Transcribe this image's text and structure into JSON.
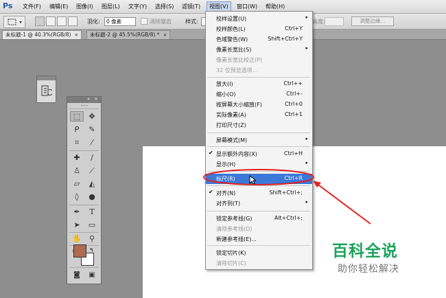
{
  "app": {
    "logo": "Ps"
  },
  "menubar": {
    "items": [
      "文件(F)",
      "编辑(E)",
      "图像(I)",
      "图层(L)",
      "文字(Y)",
      "选择(S)",
      "滤镜(T)",
      "视图(V)",
      "窗口(W)",
      "帮助(H)"
    ]
  },
  "options": {
    "feather_label": "羽化:",
    "feather_value": "0 像素",
    "antialias_label": "消除锯齿",
    "style_label": "样式:",
    "height_label": "高度:",
    "refine_edge": "调整边缘..."
  },
  "tabs": [
    {
      "label": "未标题-1 @ 40.3%(RGB/8)",
      "close": "×"
    },
    {
      "label": "未标题-2 @ 45.5%(RGB/8) *",
      "close": "×"
    }
  ],
  "view_menu": {
    "items": [
      {
        "label": "校样设置(U)",
        "shortcut": "",
        "submenu": true,
        "disabled": false,
        "checked": false
      },
      {
        "label": "校样颜色(L)",
        "shortcut": "Ctrl+Y",
        "submenu": false,
        "disabled": false,
        "checked": false
      },
      {
        "label": "色域警告(W)",
        "shortcut": "Shift+Ctrl+Y",
        "submenu": false,
        "disabled": false,
        "checked": false
      },
      {
        "label": "像素长宽比(S)",
        "shortcut": "",
        "submenu": true,
        "disabled": false,
        "checked": false
      },
      {
        "label": "像素长宽比校正(P)",
        "shortcut": "",
        "submenu": false,
        "disabled": true,
        "checked": false
      },
      {
        "label": "32 位预览选项...",
        "shortcut": "",
        "submenu": false,
        "disabled": true,
        "checked": false
      },
      {
        "label": "放大(I)",
        "shortcut": "Ctrl++",
        "submenu": false,
        "disabled": false,
        "checked": false
      },
      {
        "label": "缩小(O)",
        "shortcut": "Ctrl+-",
        "submenu": false,
        "disabled": false,
        "checked": false
      },
      {
        "label": "按屏幕大小缩放(F)",
        "shortcut": "Ctrl+0",
        "submenu": false,
        "disabled": false,
        "checked": false
      },
      {
        "label": "实际像素(A)",
        "shortcut": "Ctrl+1",
        "submenu": false,
        "disabled": false,
        "checked": false
      },
      {
        "label": "打印尺寸(Z)",
        "shortcut": "",
        "submenu": false,
        "disabled": false,
        "checked": false
      },
      {
        "label": "屏幕模式(M)",
        "shortcut": "",
        "submenu": true,
        "disabled": false,
        "checked": false
      },
      {
        "label": "显示额外内容(X)",
        "shortcut": "Ctrl+H",
        "submenu": false,
        "disabled": false,
        "checked": true
      },
      {
        "label": "显示(H)",
        "shortcut": "",
        "submenu": true,
        "disabled": false,
        "checked": false
      },
      {
        "label": "标尺(R)",
        "shortcut": "Ctrl+R",
        "submenu": false,
        "disabled": false,
        "checked": false,
        "highlighted": true
      },
      {
        "label": "对齐(N)",
        "shortcut": "Shift+Ctrl+;",
        "submenu": false,
        "disabled": false,
        "checked": true
      },
      {
        "label": "对齐到(T)",
        "shortcut": "",
        "submenu": true,
        "disabled": false,
        "checked": false
      },
      {
        "label": "锁定参考线(G)",
        "shortcut": "Alt+Ctrl+;",
        "submenu": false,
        "disabled": false,
        "checked": false
      },
      {
        "label": "清除参考线(D)",
        "shortcut": "",
        "submenu": false,
        "disabled": true,
        "checked": false
      },
      {
        "label": "新建参考线(E)...",
        "shortcut": "",
        "submenu": false,
        "disabled": false,
        "checked": false
      },
      {
        "label": "锁定切片(K)",
        "shortcut": "",
        "submenu": false,
        "disabled": false,
        "checked": false
      },
      {
        "label": "清除切片(C)",
        "shortcut": "",
        "submenu": false,
        "disabled": true,
        "checked": false
      }
    ]
  },
  "colors": {
    "foreground": "#b06a50",
    "background": "#ffffff",
    "highlight": "#3c78d8",
    "annotation_red": "#e02020",
    "watermark_green": "#1aa35a"
  },
  "watermark": {
    "title": "百科全说",
    "subtitle": "助你轻松解决"
  }
}
